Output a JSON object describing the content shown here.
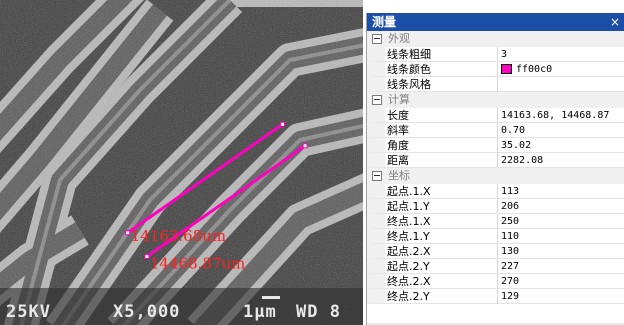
{
  "sem": {
    "measurement_color": "#ff00c0",
    "label_color": "#ff2020",
    "labels": [
      "14163.68um",
      "14468.87um"
    ],
    "info_bar": {
      "voltage": "25KV",
      "magnification": "X5,000",
      "scale": "1μm",
      "wd": "WD 8"
    }
  },
  "panel": {
    "title": "测量",
    "close_glyph": "×",
    "groups": [
      {
        "name": "外观",
        "rows": [
          {
            "name": "线条粗细",
            "value": "3"
          },
          {
            "name": "线条颜色",
            "value": "ff00c0",
            "swatch": "#ff00c0"
          },
          {
            "name": "线条风格",
            "value": ""
          }
        ]
      },
      {
        "name": "计算",
        "rows": [
          {
            "name": "长度",
            "value": "14163.68, 14468.87"
          },
          {
            "name": "斜率",
            "value": "0.70"
          },
          {
            "name": "角度",
            "value": "35.02"
          },
          {
            "name": "距离",
            "value": "2282.08"
          }
        ]
      },
      {
        "name": "坐标",
        "rows": [
          {
            "name": "起点.1.X",
            "value": "113"
          },
          {
            "name": "起点.1.Y",
            "value": "206"
          },
          {
            "name": "终点.1.X",
            "value": "250"
          },
          {
            "name": "终点.1.Y",
            "value": "110"
          },
          {
            "name": "起点.2.X",
            "value": "130"
          },
          {
            "name": "起点.2.Y",
            "value": "227"
          },
          {
            "name": "终点.2.X",
            "value": "270"
          },
          {
            "name": "终点.2.Y",
            "value": "129"
          }
        ]
      }
    ]
  }
}
